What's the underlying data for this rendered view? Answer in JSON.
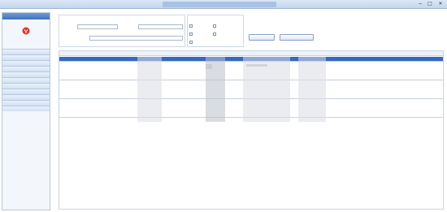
{
  "window": {
    "title": "",
    "controls": {
      "minimize": "−",
      "maximize": "□",
      "close": "✕"
    }
  },
  "topbar": {
    "item1": "",
    "item2": ""
  },
  "sidebar": {
    "header": "",
    "icon_label": "",
    "items": [
      "",
      "",
      "",
      "",
      "",
      "",
      "",
      "",
      "",
      "",
      ""
    ]
  },
  "filters": {
    "section1_title": "",
    "section2_title": "",
    "labels": [
      "",
      "",
      ""
    ],
    "checkbox_labels": [
      "",
      "",
      "",
      "",
      ""
    ],
    "button1": "",
    "button2": ""
  },
  "table": {
    "headers": [
      "",
      "",
      "",
      "",
      "",
      "",
      "",
      ""
    ],
    "rows": [
      [
        "",
        "",
        "",
        "",
        "",
        "",
        "",
        ""
      ],
      [
        "",
        "",
        "",
        "",
        "",
        "",
        "",
        ""
      ],
      [
        "",
        "",
        "",
        "",
        "",
        "",
        "",
        ""
      ],
      [
        "",
        "",
        "",
        "",
        "",
        "",
        "",
        ""
      ],
      [
        "",
        "",
        "",
        "",
        "",
        "",
        "",
        ""
      ],
      [
        "",
        "",
        "",
        "",
        "",
        "",
        "",
        ""
      ],
      [
        "",
        "",
        "",
        "",
        "",
        "",
        "",
        ""
      ],
      [
        "",
        "",
        "",
        "",
        "",
        "",
        "",
        ""
      ],
      [
        "",
        "",
        "",
        "",
        "",
        "",
        "",
        ""
      ],
      [
        "",
        "",
        "",
        "",
        "",
        "",
        "",
        ""
      ],
      [
        "",
        "",
        "",
        "",
        "",
        "",
        "",
        ""
      ],
      [
        "",
        "",
        "",
        "",
        "",
        "",
        "",
        ""
      ],
      [
        "",
        "",
        "",
        "",
        "",
        "",
        "",
        ""
      ],
      [
        "",
        "",
        "",
        "",
        "",
        "",
        "",
        ""
      ],
      [
        "",
        "",
        "",
        "",
        "",
        "",
        "",
        ""
      ],
      [
        "",
        "",
        "",
        "",
        "",
        "",
        "",
        ""
      ],
      [
        "",
        "",
        "",
        "",
        "",
        "",
        "",
        ""
      ],
      [
        "",
        "",
        "",
        "",
        "",
        "",
        "",
        ""
      ]
    ],
    "selected_row": 0
  },
  "colors": {
    "accent": "#3568c4",
    "sidebar_header": "#4f82c9",
    "titlebar": "#c4d6ee"
  }
}
